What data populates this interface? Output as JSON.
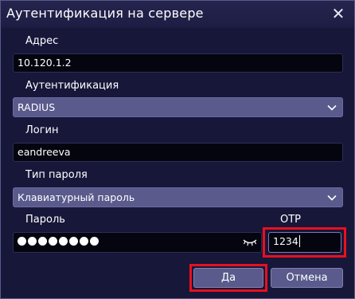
{
  "dialog": {
    "title": "Аутентификация на сервере",
    "close_glyph": "✕"
  },
  "address": {
    "label": "Адрес",
    "value": "10.120.1.2"
  },
  "auth": {
    "label": "Аутентификация",
    "selected": "RADIUS",
    "icon": "chevron-down-icon"
  },
  "login": {
    "label": "Логин",
    "value": "eandreeva"
  },
  "password_type": {
    "label": "Тип пароля",
    "selected": "Клавиатурный пароль",
    "icon": "chevron-down-icon"
  },
  "password": {
    "label": "Пароль",
    "masked_length": 8,
    "toggle_icon": "eye-closed-icon"
  },
  "otp": {
    "label": "OTP",
    "value": "1234"
  },
  "buttons": {
    "ok": "Да",
    "cancel": "Отмена"
  },
  "colors": {
    "background": "#17173a",
    "field_bg": "#050510",
    "select_bg": "#5a5a8c",
    "highlight": "#e8101c"
  }
}
